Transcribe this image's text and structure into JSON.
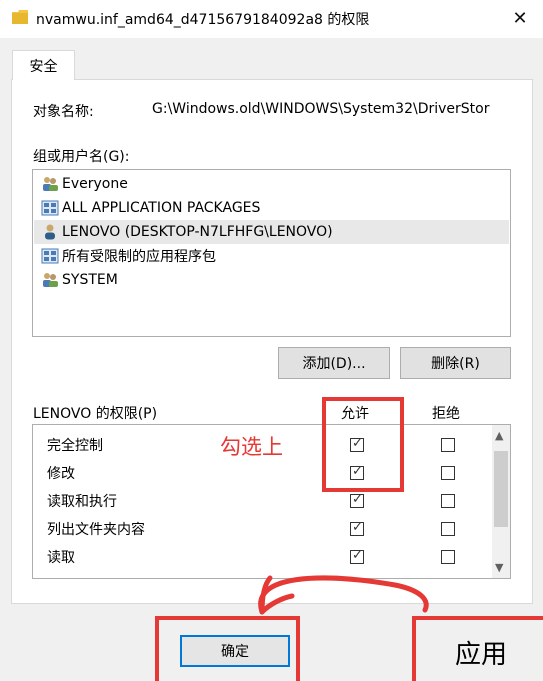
{
  "window": {
    "title": "nvamwu.inf_amd64_d4715679184092a8 的权限",
    "close_glyph": "✕"
  },
  "tab": {
    "label": "安全"
  },
  "object": {
    "label": "对象名称:",
    "value": "G:\\Windows.old\\WINDOWS\\System32\\DriverStor"
  },
  "groups": {
    "label": "组或用户名(G):",
    "items": [
      {
        "label": "Everyone",
        "icon": "group-users-icon"
      },
      {
        "label": "ALL APPLICATION PACKAGES",
        "icon": "app-packages-icon"
      },
      {
        "label": "LENOVO (DESKTOP-N7LFHFG\\LENOVO)",
        "icon": "user-icon",
        "selected": true
      },
      {
        "label": "所有受限制的应用程序包",
        "icon": "app-packages-icon"
      },
      {
        "label": "SYSTEM",
        "icon": "group-users-icon"
      }
    ]
  },
  "buttons": {
    "add": "添加(D)...",
    "remove": "删除(R)",
    "ok": "确定",
    "apply": "应用"
  },
  "permissions": {
    "label": "LENOVO 的权限(P)",
    "allow_header": "允许",
    "deny_header": "拒绝",
    "rows": [
      {
        "name": "完全控制",
        "allow": true,
        "deny": false
      },
      {
        "name": "修改",
        "allow": true,
        "deny": false
      },
      {
        "name": "读取和执行",
        "allow": true,
        "deny": false
      },
      {
        "name": "列出文件夹内容",
        "allow": true,
        "deny": false
      },
      {
        "name": "读取",
        "allow": true,
        "deny": false
      }
    ]
  },
  "annotation": {
    "text": "勾选上",
    "color": "#e53935"
  },
  "scroll": {
    "up": "▲",
    "down": "▼"
  }
}
